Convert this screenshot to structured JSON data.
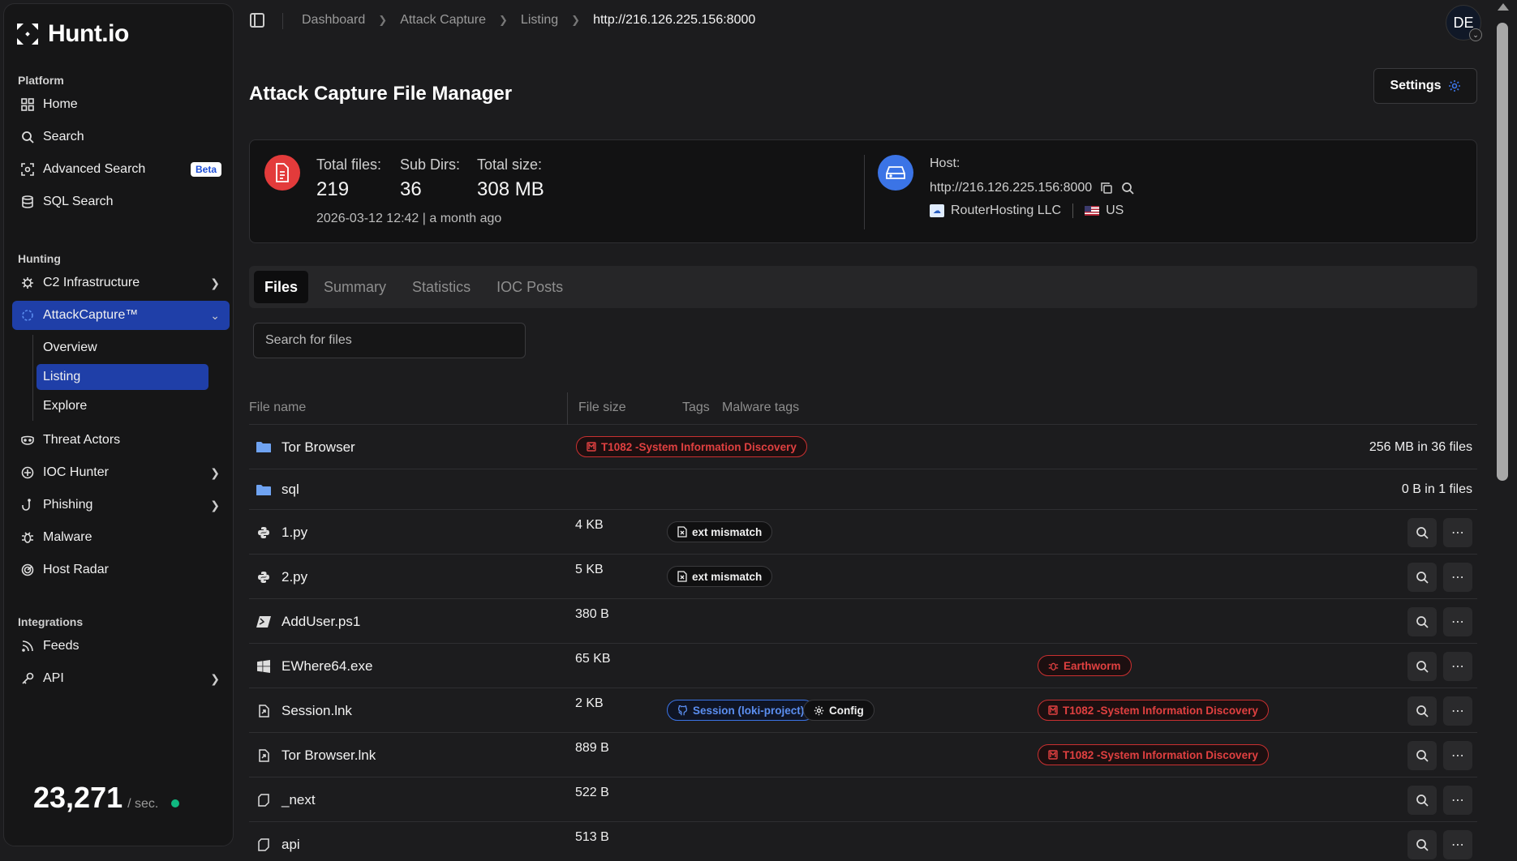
{
  "brand": {
    "name": "Hunt.io"
  },
  "sidebar": {
    "platform_label": "Platform",
    "platform_items": [
      {
        "label": "Home",
        "icon": "grid-icon"
      },
      {
        "label": "Search",
        "icon": "search-icon"
      },
      {
        "label": "Advanced Search",
        "icon": "scan-icon",
        "badge": "Beta"
      },
      {
        "label": "SQL Search",
        "icon": "database-icon"
      }
    ],
    "hunting_label": "Hunting",
    "hunting_items": [
      {
        "label": "C2 Infrastructure",
        "icon": "virus-icon"
      },
      {
        "label": "AttackCapture™",
        "icon": "attack-capture-icon"
      },
      {
        "label": "Threat Actors",
        "icon": "mask-icon"
      },
      {
        "label": "IOC Hunter",
        "icon": "crosshair-icon"
      },
      {
        "label": "Phishing",
        "icon": "hook-icon"
      },
      {
        "label": "Malware",
        "icon": "bug-icon"
      },
      {
        "label": "Host Radar",
        "icon": "radar-icon"
      }
    ],
    "attack_sub": [
      "Overview",
      "Listing",
      "Explore"
    ],
    "integrations_label": "Integrations",
    "integration_items": [
      {
        "label": "Feeds",
        "icon": "rss-icon"
      },
      {
        "label": "API",
        "icon": "key-icon"
      }
    ],
    "rate": {
      "value": "23,271",
      "unit": "/ sec."
    }
  },
  "breadcrumb": [
    "Dashboard",
    "Attack Capture",
    "Listing",
    "http://216.126.225.156:8000"
  ],
  "user": {
    "initials": "DE"
  },
  "page": {
    "title": "Attack Capture File Manager",
    "settings_label": "Settings"
  },
  "summary": {
    "total_files_label": "Total files:",
    "total_files": "219",
    "sub_dirs_label": "Sub Dirs:",
    "sub_dirs": "36",
    "total_size_label": "Total size:",
    "total_size": "308 MB",
    "date": "2026-03-12 12:42 | a month ago",
    "host_label": "Host:",
    "host_url": "http://216.126.225.156:8000",
    "provider": "RouterHosting LLC",
    "country": "US"
  },
  "tabs": [
    "Files",
    "Summary",
    "Statistics",
    "IOC Posts"
  ],
  "search": {
    "placeholder": "Search for files"
  },
  "columns": {
    "name": "File name",
    "size": "File size",
    "tags": "Tags",
    "malware": "Malware tags"
  },
  "rows": [
    {
      "name": "Tor Browser",
      "icon": "folder-icon",
      "size": "",
      "summary": "256 MB in 36 files",
      "mitre": "T1082 -System Information Discovery"
    },
    {
      "name": "sql",
      "icon": "folder-icon",
      "size": "",
      "summary": "0 B in 1 files"
    },
    {
      "name": "1.py",
      "icon": "python-icon",
      "size": "4 KB",
      "tag": "ext mismatch"
    },
    {
      "name": "2.py",
      "icon": "python-icon",
      "size": "5 KB",
      "tag": "ext mismatch"
    },
    {
      "name": "AddUser.ps1",
      "icon": "powershell-icon",
      "size": "380 B"
    },
    {
      "name": "EWhere64.exe",
      "icon": "windows-icon",
      "size": "65 KB",
      "malware": "Earthworm"
    },
    {
      "name": "Session.lnk",
      "icon": "shortcut-icon",
      "size": "2 KB",
      "tag_blue": "Session (loki-project)",
      "tag_config": "Config",
      "malware": "T1082 -System Information Discovery"
    },
    {
      "name": "Tor Browser.lnk",
      "icon": "shortcut-icon",
      "size": "889 B",
      "malware": "T1082 -System Information Discovery"
    },
    {
      "name": "_next",
      "icon": "file-icon",
      "size": "522 B"
    },
    {
      "name": "api",
      "icon": "file-icon",
      "size": "513 B"
    }
  ],
  "colors": {
    "accent": "#1f3fa8",
    "danger": "#e04040",
    "info": "#3b74e6",
    "success": "#10b981"
  }
}
